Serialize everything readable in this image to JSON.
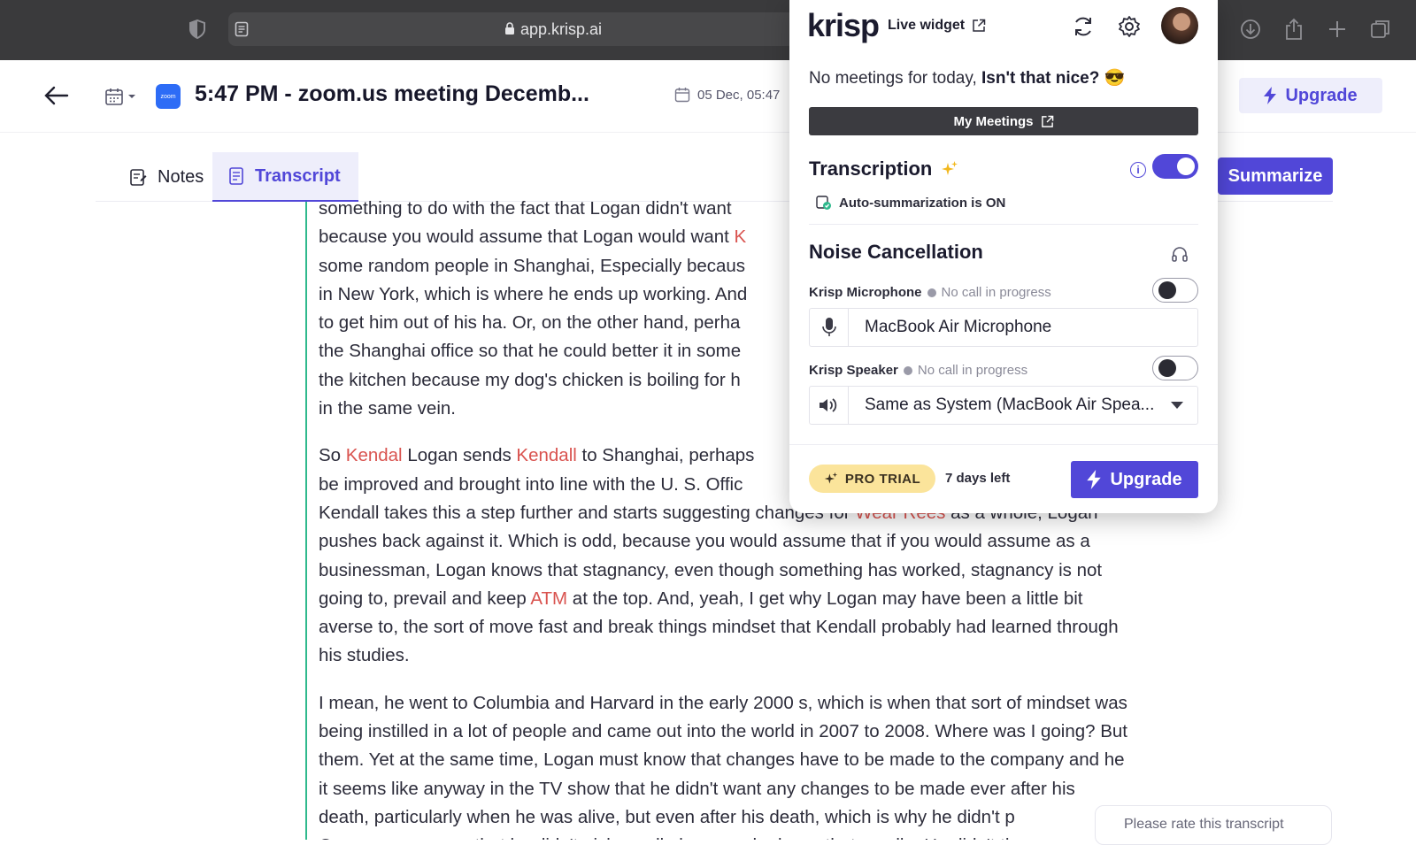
{
  "browser": {
    "address": "app.krisp.ai"
  },
  "header": {
    "title": "5:47 PM - zoom.us meeting Decemb...",
    "zoom_badge": "zoom",
    "date": "05 Dec, 05:47",
    "upgrade_label": "Upgrade"
  },
  "tabs": {
    "notes": "Notes",
    "transcript": "Transcript",
    "summarize": "Summarize"
  },
  "transcript": {
    "p1": [
      {
        "t": "something to do with the fact that Logan didn't want "
      },
      {
        "t": "",
        "hl": true
      },
      {
        "t": "because you would assume that Logan would want "
      },
      {
        "t": "K",
        "hl": true
      },
      {
        "t": "some random people in Shanghai, Especially becaus"
      },
      {
        "t": "in New York, which is where he ends up working. And"
      },
      {
        "t": "to get him out of his ha. Or, on the other hand, perha"
      },
      {
        "t": "the Shanghai office so that he could better it in some"
      },
      {
        "t": "the kitchen because my dog's chicken is boiling for h"
      },
      {
        "t": "in the same vein."
      }
    ],
    "p2": [
      {
        "t": "So "
      },
      {
        "t": "Kendal",
        "hl": true
      },
      {
        "t": " Logan sends "
      },
      {
        "t": "Kendall",
        "hl": true
      },
      {
        "t": " to Shanghai, perhaps"
      },
      {
        "t": "be improved and brought into line with the U. S. Offic"
      },
      {
        "t": "Kendall takes this a step further and starts suggesting changes for "
      },
      {
        "t": "Wear Rees",
        "hl": true
      },
      {
        "t": " as a whole, Logan"
      },
      {
        "t": "pushes back against it. Which is odd, because you would assume that if you would assume as a"
      },
      {
        "t": "businessman, Logan knows that stagnancy, even though something has worked, stagnancy is not"
      },
      {
        "t": "going to, prevail and keep "
      },
      {
        "t": "ATM",
        "hl": true
      },
      {
        "t": " at the top. And, yeah, I get why Logan may have been a little bit"
      },
      {
        "t": "averse to, the sort of move fast and break things mindset that Kendall probably had learned through"
      },
      {
        "t": "his studies."
      }
    ],
    "p3": [
      "I mean, he went to Columbia and Harvard in the early 2000 s, which is when that sort of mindset was",
      "being instilled in a lot of people and came out into the world in 2007 to 2008. Where was I going? But",
      "them. Yet at the same time, Logan must know that changes have to be made to the company and he",
      "it seems like anyway in the TV show that he didn't want any changes to be made ever after his",
      "death, particularly when he was alive, but even after his death, which is why he didn't p",
      "Or we can assume that he didn't pick candle because he knew that candle. He didn't th"
    ]
  },
  "rate": {
    "label": "Please rate this transcript"
  },
  "krisp": {
    "logo": "krisp",
    "live_widget": "Live widget",
    "no_meetings_prefix": "No meetings for today, ",
    "no_meetings_bold": "Isn't that nice?",
    "no_meetings_emoji": "😎",
    "my_meetings": "My Meetings",
    "transcription_title": "Transcription",
    "transcription_on": true,
    "auto_summarization": "Auto-summarization is ON",
    "noise_title": "Noise Cancellation",
    "mic_label": "Krisp Microphone",
    "mic_status": "No call in progress",
    "mic_on": false,
    "mic_device": "MacBook Air Microphone",
    "speaker_label": "Krisp Speaker",
    "speaker_status": "No call in progress",
    "speaker_on": false,
    "speaker_device": "Same as System (MacBook Air Spea...",
    "pro_trial": "PRO TRIAL",
    "days_left": "7 days left",
    "upgrade": "Upgrade"
  },
  "colors": {
    "accent": "#5147d8",
    "highlight": "#d9534f",
    "rule": "#2fb98d"
  }
}
